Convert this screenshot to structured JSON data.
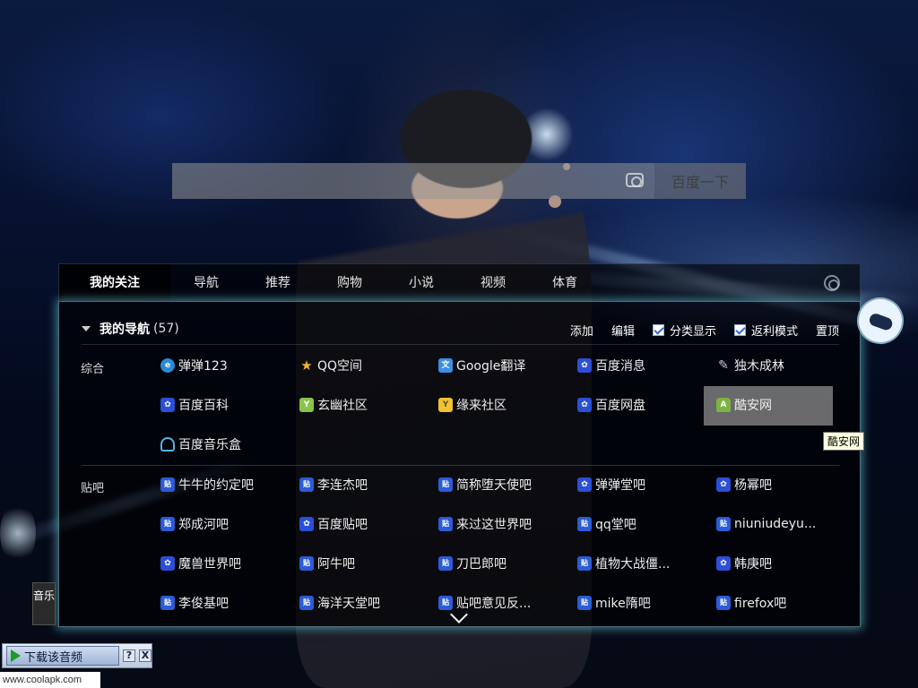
{
  "search": {
    "placeholder": "",
    "button": "百度一下"
  },
  "tabs": [
    "我的关注",
    "导航",
    "推荐",
    "购物",
    "小说",
    "视频",
    "体育"
  ],
  "nav": {
    "title": "我的导航",
    "count": "(57)",
    "actions": {
      "add": "添加",
      "edit": "编辑",
      "category_display": "分类显示",
      "rebate_mode": "返利模式",
      "pin_top": "置顶"
    }
  },
  "sections": [
    {
      "label": "综合",
      "links": [
        {
          "text": "弹弹123",
          "icon": "ie-icon"
        },
        {
          "text": "QQ空间",
          "icon": "star-icon"
        },
        {
          "text": "Google翻译",
          "icon": "translate-icon"
        },
        {
          "text": "百度消息",
          "icon": "baidu-paw-icon"
        },
        {
          "text": "独木成林",
          "icon": "pin-icon"
        },
        {
          "text": "百度百科",
          "icon": "baidu-paw-icon"
        },
        {
          "text": "玄幽社区",
          "icon": "ys-icon"
        },
        {
          "text": "缘来社区",
          "icon": "yl-icon"
        },
        {
          "text": "百度网盘",
          "icon": "baidu-paw-icon"
        },
        {
          "text": "酷安网",
          "icon": "android-icon"
        },
        {
          "text": "百度音乐盒",
          "icon": "headphones-icon"
        }
      ]
    },
    {
      "label": "贴吧",
      "links": [
        {
          "text": "牛牛的约定吧",
          "icon": "tieba-icon"
        },
        {
          "text": "李连杰吧",
          "icon": "tieba-icon"
        },
        {
          "text": "简称堕天使吧",
          "icon": "tieba-icon"
        },
        {
          "text": "弹弹堂吧",
          "icon": "baidu-paw-icon"
        },
        {
          "text": "杨幂吧",
          "icon": "baidu-paw-icon"
        },
        {
          "text": "郑成河吧",
          "icon": "tieba-icon"
        },
        {
          "text": "百度贴吧",
          "icon": "baidu-paw-icon"
        },
        {
          "text": "来过这世界吧",
          "icon": "tieba-icon"
        },
        {
          "text": "qq堂吧",
          "icon": "tieba-icon"
        },
        {
          "text": "niuniudeyu...",
          "icon": "tieba-icon"
        },
        {
          "text": "魔兽世界吧",
          "icon": "baidu-paw-icon"
        },
        {
          "text": "阿牛吧",
          "icon": "tieba-icon"
        },
        {
          "text": "刀巴郎吧",
          "icon": "tieba-icon"
        },
        {
          "text": "植物大战僵...",
          "icon": "tieba-icon"
        },
        {
          "text": "韩庚吧",
          "icon": "baidu-paw-icon"
        },
        {
          "text": "李俊基吧",
          "icon": "tieba-icon"
        },
        {
          "text": "海洋天堂吧",
          "icon": "tieba-icon"
        },
        {
          "text": "贴吧意见反...",
          "icon": "tieba-icon"
        },
        {
          "text": "mike隋吧",
          "icon": "tieba-icon"
        },
        {
          "text": "firefox吧",
          "icon": "tieba-icon"
        }
      ]
    }
  ],
  "tooltip": "酷安网",
  "music_tab": "音乐",
  "download": {
    "label": "下载该音频",
    "help": "?",
    "close": "X"
  },
  "watermark": "www.coolapk.com",
  "colors": {
    "accent_glow": "#64c8dc",
    "highlight": "#8c8c8c"
  }
}
